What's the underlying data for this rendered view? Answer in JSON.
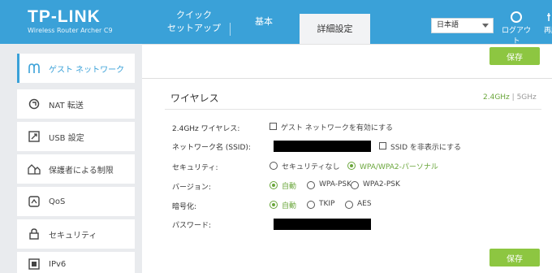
{
  "header": {
    "brand": "TP-LINK",
    "model": "Wireless Router Archer C9",
    "tabs": [
      {
        "label": "クイック\nセットアップ"
      },
      {
        "label": "基本"
      },
      {
        "label": "詳細設定"
      }
    ],
    "language": "日本語",
    "logout_label": "ログアウト",
    "reboot_label": "再起"
  },
  "sidebar": {
    "items": [
      {
        "label": "ゲスト ネットワーク",
        "icon": "guest-network-icon"
      },
      {
        "label": "NAT 転送",
        "icon": "nat-icon"
      },
      {
        "label": "USB 設定",
        "icon": "usb-icon"
      },
      {
        "label": "保護者による制限",
        "icon": "parental-icon"
      },
      {
        "label": "QoS",
        "icon": "qos-icon"
      },
      {
        "label": "セキュリティ",
        "icon": "lock-icon"
      },
      {
        "label": "IPv6",
        "icon": "ipv6-icon"
      }
    ]
  },
  "main": {
    "save_label": "保存",
    "section_title": "ワイヤレス",
    "band_24": "2.4GHz",
    "band_sep": "|",
    "band_5": "5GHz",
    "rows": {
      "wireless_label": "2.4GHz ワイヤレス:",
      "enable_guest_label": "ゲスト ネットワークを有効にする",
      "ssid_label": "ネットワーク名 (SSID):",
      "hide_ssid_label": "SSID を非表示にする",
      "security_label": "セキュリティ:",
      "security_none": "セキュリティなし",
      "security_wpa": "WPA/WPA2-パーソナル",
      "version_label": "バージョン:",
      "version_auto": "自動",
      "version_wpa": "WPA-PSK",
      "version_wpa2": "WPA2-PSK",
      "encryption_label": "暗号化:",
      "enc_auto": "自動",
      "enc_tkip": "TKIP",
      "enc_aes": "AES",
      "password_label": "パスワード:"
    }
  },
  "colors": {
    "header": "#3aa1d8",
    "accent_green": "#8dc641",
    "selected_green": "#6aa63b"
  }
}
